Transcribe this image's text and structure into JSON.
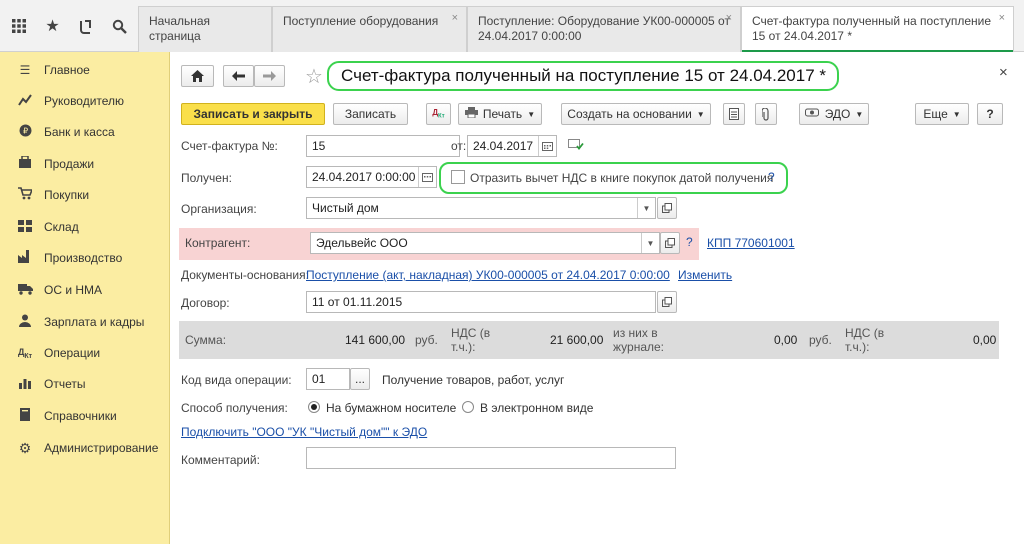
{
  "topbar": {
    "tabs": [
      {
        "label": "Начальная страница",
        "closable": false
      },
      {
        "label": "Поступление оборудования",
        "closable": true
      },
      {
        "label": "Поступление: Оборудование УК00-000005 от 24.04.2017 0:00:00",
        "closable": true
      },
      {
        "label": "Счет-фактура полученный на поступление 15 от 24.04.2017 *",
        "closable": true
      }
    ],
    "close_glyph": "×"
  },
  "sidebar": {
    "items": [
      {
        "label": "Главное",
        "icon": "menu-icon"
      },
      {
        "label": "Руководителю",
        "icon": "chart-line-icon"
      },
      {
        "label": "Банк и касса",
        "icon": "coin-icon"
      },
      {
        "label": "Продажи",
        "icon": "cart-icon"
      },
      {
        "label": "Покупки",
        "icon": "basket-icon"
      },
      {
        "label": "Склад",
        "icon": "warehouse-icon"
      },
      {
        "label": "Производство",
        "icon": "factory-icon"
      },
      {
        "label": "ОС и НМА",
        "icon": "truck-icon"
      },
      {
        "label": "Зарплата и кадры",
        "icon": "person-icon"
      },
      {
        "label": "Операции",
        "icon": "dt-kt-icon"
      },
      {
        "label": "Отчеты",
        "icon": "bar-chart-icon"
      },
      {
        "label": "Справочники",
        "icon": "book-icon"
      },
      {
        "label": "Администрирование",
        "icon": "gear-icon"
      }
    ]
  },
  "form": {
    "title": "Счет-фактура полученный на поступление 15 от 24.04.2017 *",
    "close_glyph": "×",
    "toolbar": {
      "save_close": "Записать и закрыть",
      "save": "Записать",
      "print": "Печать",
      "create_based": "Создать на основании",
      "edo": "ЭДО",
      "more": "Еще",
      "help": "?"
    },
    "invoice_number_label": "Счет-фактура №:",
    "invoice_number": "15",
    "date_label": "от:",
    "date": "24.04.2017",
    "received_label": "Получен:",
    "received": "24.04.2017  0:00:00",
    "vat_checkbox_label": "Отразить вычет НДС в книге покупок датой получения",
    "vat_checkbox_help": "?",
    "organization_label": "Организация:",
    "organization": "Чистый дом",
    "counterparty_label": "Контрагент:",
    "counterparty": "Эдельвейс ООО",
    "counterparty_help": "?",
    "kpp_link": "КПП 770601001",
    "base_docs_label": "Документы-основания:",
    "base_docs_link": "Поступление (акт, накладная) УК00-000005 от 24.04.2017 0:00:00",
    "change_link": "Изменить",
    "contract_label": "Договор:",
    "contract": "11 от 01.11.2015",
    "summary": {
      "sum_label": "Сумма:",
      "sum_value": "141 600,00",
      "currency": "руб.",
      "vat_label_1": "НДС (в",
      "vat_label_2": "т.ч.):",
      "vat_value": "21 600,00",
      "journal_label_1": "из них в",
      "journal_label_2": "журнале:",
      "journal_value": "0,00",
      "currency2": "руб.",
      "vat2_label_1": "НДС (в",
      "vat2_label_2": "т.ч.):",
      "vat2_value": "0,00"
    },
    "op_code_label": "Код вида операции:",
    "op_code": "01",
    "op_code_btn": "...",
    "op_code_desc": "Получение товаров, работ, услуг",
    "method_label": "Способ получения:",
    "method_paper": "На бумажном носителе",
    "method_electronic": "В электронном виде",
    "edo_link": "Подключить \"ООО \"УК \"Чистый дом\"\" к ЭДО",
    "comment_label": "Комментарий:",
    "comment": ""
  }
}
